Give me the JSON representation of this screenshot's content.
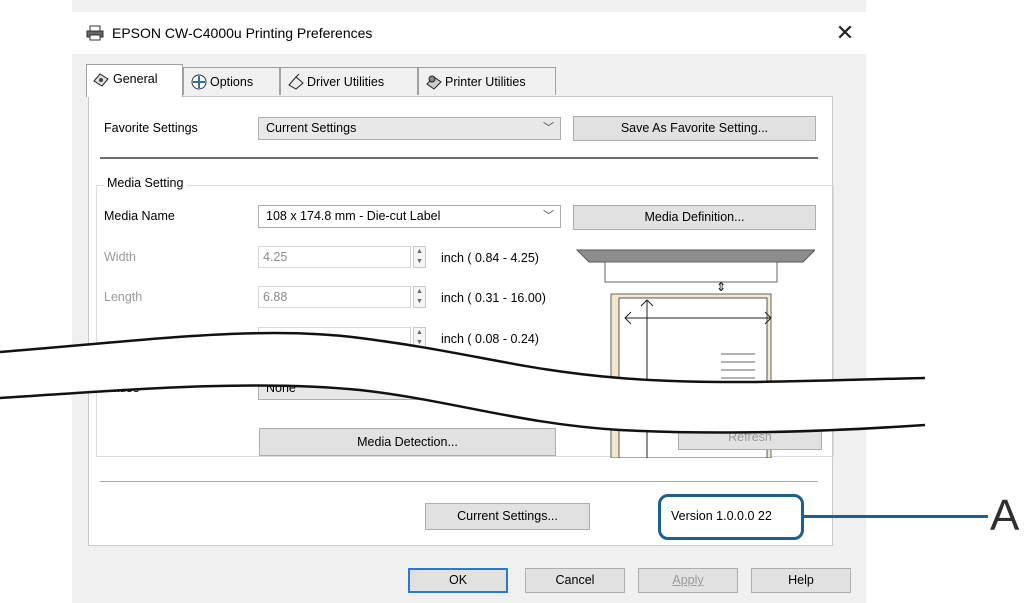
{
  "window": {
    "title": "EPSON CW-C4000u Printing Preferences"
  },
  "tabs": [
    {
      "label": "General"
    },
    {
      "label": "Options"
    },
    {
      "label": "Driver Utilities"
    },
    {
      "label": "Printer Utilities"
    }
  ],
  "favorite": {
    "label": "Favorite Settings",
    "value": "Current Settings",
    "save_button": "Save As Favorite Setting..."
  },
  "media": {
    "group_title": "Media Setting",
    "name_label": "Media Name",
    "name_value": "108 x 174.8 mm - Die-cut Label",
    "definition_button": "Media Definition...",
    "width_label": "Width",
    "width_value": "4.25",
    "width_range": "inch ( 0.84 -  4.25)",
    "length_label": "Length",
    "length_value": "6.88",
    "length_range": "inch ( 0.31 - 16.00)",
    "gap_range": "inch ( 0.08 -  0.24)",
    "pause_label": "Pause",
    "pause_value": "None",
    "detection_button": "Media Detection...",
    "refresh_button": "Refresh"
  },
  "footer": {
    "current_settings_button": "Current Settings...",
    "version": "Version 1.0.0.0 22"
  },
  "dialog_buttons": {
    "ok": "OK",
    "cancel": "Cancel",
    "apply": "Apply",
    "help": "Help"
  },
  "callout": {
    "letter": "A"
  },
  "colors": {
    "callout": "#1b5f93",
    "ok_border": "#2a78d3",
    "window_bg": "#f0f0f0"
  }
}
